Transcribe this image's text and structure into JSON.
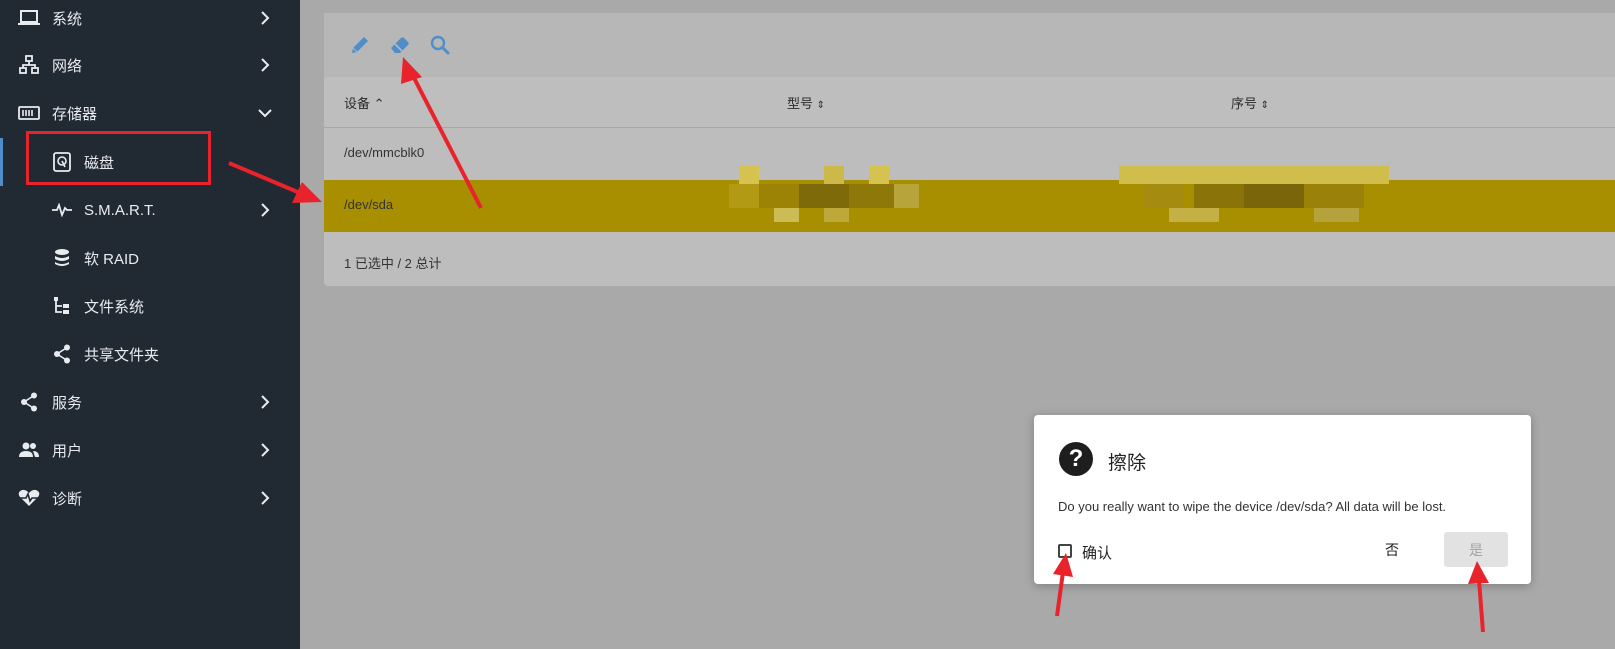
{
  "sidebar": {
    "items": [
      {
        "label": "系统",
        "icon": "laptop-icon"
      },
      {
        "label": "网络",
        "icon": "network-icon"
      },
      {
        "label": "存储器",
        "icon": "storage-icon"
      },
      {
        "label": "磁盘",
        "icon": "disk-icon"
      },
      {
        "label": "S.M.A.R.T.",
        "icon": "pulse-icon"
      },
      {
        "label": "软 RAID",
        "icon": "database-icon"
      },
      {
        "label": "文件系统",
        "icon": "file-tree-icon"
      },
      {
        "label": "共享文件夹",
        "icon": "share-icon"
      },
      {
        "label": "服务",
        "icon": "share-icon"
      },
      {
        "label": "用户",
        "icon": "users-icon"
      },
      {
        "label": "诊断",
        "icon": "heart-pulse-icon"
      }
    ]
  },
  "toolbar": {
    "edit_icon": "pencil-icon",
    "wipe_icon": "eraser-icon",
    "search_icon": "magnify-icon"
  },
  "table": {
    "headers": [
      "设备",
      "型号",
      "序号"
    ],
    "rows": [
      {
        "device": "/dev/mmcblk0"
      },
      {
        "device": "/dev/sda"
      }
    ],
    "footer": "1 已选中 / 2 总计"
  },
  "dialog": {
    "title": "擦除",
    "message": "Do you really want to wipe the device /dev/sda? All data will be lost.",
    "confirm_label": "确认",
    "no_label": "否",
    "yes_label": "是"
  },
  "colors": {
    "sidebar_bg": "#212932",
    "accent": "#4e8ecb",
    "selected_row": "#a88f00",
    "annotation": "#e8232b"
  }
}
